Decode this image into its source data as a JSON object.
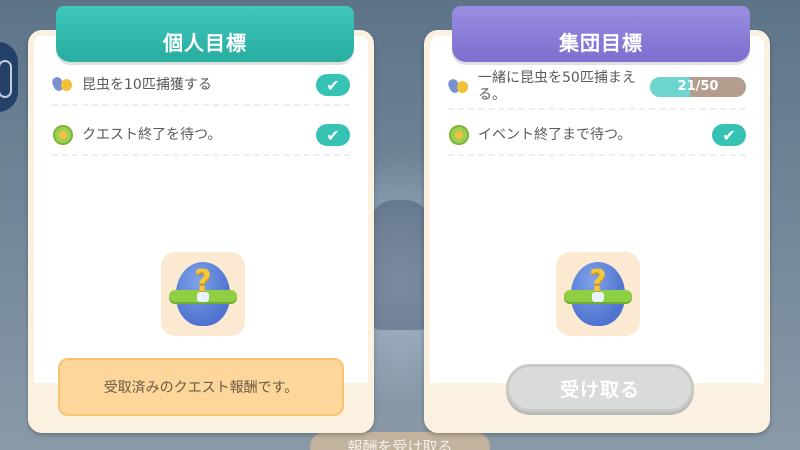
{
  "personal_panel": {
    "title": "個人目標",
    "tasks": [
      {
        "icon": "bug-icon",
        "label": "昆虫を10匹捕獲する",
        "status": "completed"
      },
      {
        "icon": "flower-icon",
        "label": "クエスト終了を待つ。",
        "status": "completed"
      }
    ],
    "reward_icon": "mystery-egg-icon",
    "notice": "受取済みのクエスト報酬です。",
    "accent": "#28ad9f"
  },
  "group_panel": {
    "title": "集団目標",
    "tasks": [
      {
        "icon": "bug-icon",
        "label": "一緒に昆虫を50匹捕まえる。",
        "progress_text": "21/50",
        "progress_value": 21,
        "progress_max": 50
      },
      {
        "icon": "flower-icon",
        "label": "イベント終了まで待つ。",
        "status": "completed"
      }
    ],
    "reward_icon": "mystery-egg-icon",
    "claim_label": "受け取る",
    "accent": "#7c6fcf"
  },
  "bottom_partial_button": "報酬を受け取る",
  "check_glyph": "✔"
}
